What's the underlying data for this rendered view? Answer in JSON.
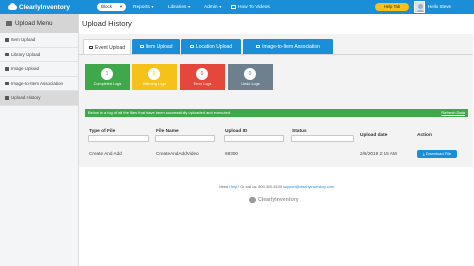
{
  "navbar": {
    "logo_text": "ClearlyInventory",
    "store_select": "Block",
    "menus": [
      {
        "label": "Reports"
      },
      {
        "label": "Libraries"
      },
      {
        "label": "Admin"
      }
    ],
    "videos_label": "How To Videos",
    "help_button": "Help Tab",
    "greeting": "Hello Steve"
  },
  "sidebar": {
    "title": "Upload Menu",
    "items": [
      {
        "label": "Item Upload",
        "icon": "upload-icon"
      },
      {
        "label": "Library Upload",
        "icon": "upload-icon"
      },
      {
        "label": "Image Upload",
        "icon": "image-icon"
      },
      {
        "label": "Image-to-Item Association",
        "icon": "link-icon"
      },
      {
        "label": "Upload History",
        "icon": "history-icon"
      }
    ]
  },
  "main": {
    "title": "Upload History",
    "tabs": [
      {
        "label": "Event Upload"
      },
      {
        "label": "Item Upload"
      },
      {
        "label": "Location Upload"
      },
      {
        "label": "Image-to-Item Association"
      }
    ],
    "stats": [
      {
        "count": "1",
        "label": "Completed Logs",
        "color": "#3ea84a"
      },
      {
        "count": "0",
        "label": "Warning Logs",
        "color": "#f4c21a"
      },
      {
        "count": "0",
        "label": "Error Logs",
        "color": "#e3483a"
      },
      {
        "count": "0",
        "label": "Undo Logs",
        "color": "#6e7f8e"
      }
    ],
    "info_text": "Below is a log of all the files that have been successfully uploaded and executed.",
    "refresh_label": "Refresh Data",
    "table": {
      "headers": [
        "Type of File",
        "File Name",
        "Upload ID",
        "Status",
        "Upload date",
        "Action"
      ],
      "rows": [
        {
          "type": "Create And Add",
          "file_name": "CreateAndAddVideo",
          "upload_id": "68300",
          "status": "",
          "upload_date": "2/6/2019 2:15 AM",
          "action": "Download File"
        }
      ]
    }
  },
  "footer": {
    "help_prefix": "Need",
    "help_link": "Help",
    "help_middle": "? Or call us: 800-300-5100",
    "email": "support@clearlyinventory.com",
    "logo_text": "ClearlyInventory"
  }
}
